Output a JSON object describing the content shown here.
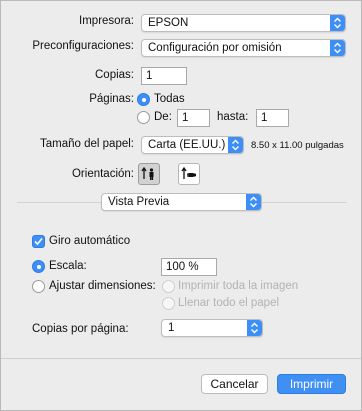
{
  "printer": {
    "label": "Impresora:",
    "value": "EPSON"
  },
  "presets": {
    "label": "Preconfiguraciones:",
    "value": "Configuración por omisión"
  },
  "copies": {
    "label": "Copias:",
    "value": "1"
  },
  "pages": {
    "label": "Páginas:",
    "all_label": "Todas",
    "from_label": "De:",
    "from_value": "1",
    "to_label": "hasta:",
    "to_value": "1",
    "selected": "all"
  },
  "paper_size": {
    "label": "Tamaño del papel:",
    "value": "Carta (EE.UU.)",
    "dimensions": "8.50 x 11.00 pulgadas"
  },
  "orientation": {
    "label": "Orientación:",
    "selected": "portrait"
  },
  "section_menu": {
    "value": "Vista Previa"
  },
  "auto_rotate": {
    "label": "Giro automático",
    "checked": true
  },
  "scale": {
    "label": "Escala:",
    "value": "100 %",
    "selected": true
  },
  "fit": {
    "label": "Ajustar dimensiones:",
    "print_entire": "Imprimir toda la imagen",
    "fill_paper": "Llenar todo el papel"
  },
  "copies_per_page": {
    "label": "Copias por página:",
    "value": "1"
  },
  "buttons": {
    "cancel": "Cancelar",
    "print": "Imprimir"
  },
  "colors": {
    "accent": "#3d8ff7",
    "background": "#ececec",
    "disabled_text": "#b3b3b3"
  },
  "icons": {
    "popup_arrows": "up-down-chevron-icon",
    "portrait": "portrait-orientation-icon",
    "landscape": "landscape-orientation-icon",
    "check": "checkmark-icon"
  }
}
